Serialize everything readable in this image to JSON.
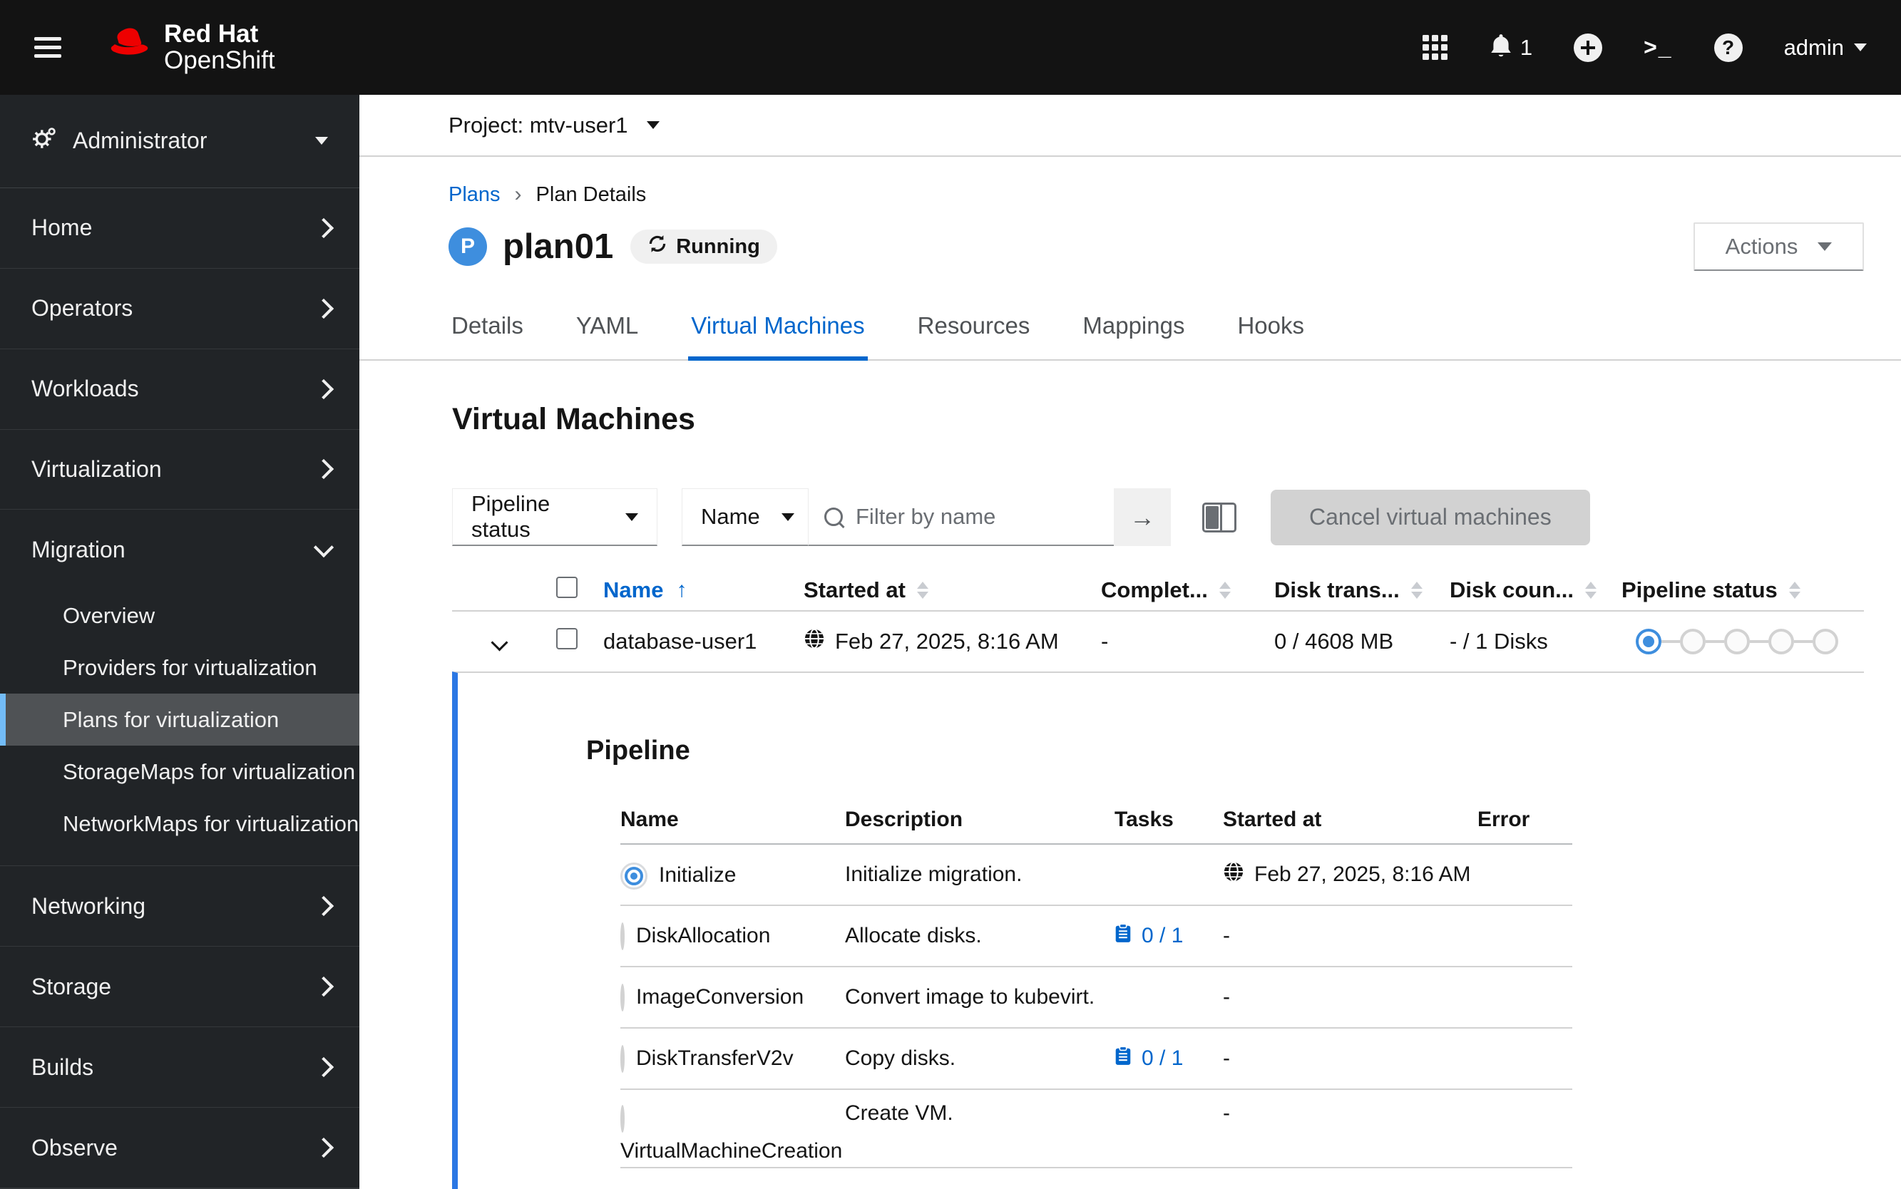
{
  "masthead": {
    "brand_line1": "Red Hat",
    "brand_line2": "OpenShift",
    "notification_count": "1",
    "username": "admin"
  },
  "sidebar": {
    "perspective": "Administrator",
    "items_before": [
      "Home",
      "Operators",
      "Workloads",
      "Virtualization"
    ],
    "migration": {
      "label": "Migration",
      "children": [
        "Overview",
        "Providers for virtualization",
        "Plans for virtualization",
        "StorageMaps for virtualization",
        "NetworkMaps for virtualization"
      ],
      "active_child": "Plans for virtualization"
    },
    "items_after": [
      "Networking",
      "Storage",
      "Builds",
      "Observe"
    ]
  },
  "project_bar": {
    "label": "Project: mtv-user1"
  },
  "page": {
    "breadcrumb": [
      "Plans",
      "Plan Details"
    ],
    "resource_badge": "P",
    "title": "plan01",
    "status": "Running",
    "actions_label": "Actions"
  },
  "tabs": [
    "Details",
    "YAML",
    "Virtual Machines",
    "Resources",
    "Mappings",
    "Hooks"
  ],
  "active_tab": "Virtual Machines",
  "main": {
    "section_title": "Virtual Machines",
    "toolbar": {
      "filter_category": "Pipeline status",
      "filter_attribute": "Name",
      "search_placeholder": "Filter by name",
      "cancel_button": "Cancel virtual machines"
    },
    "vm_table": {
      "headers": [
        "Name",
        "Started at",
        "Complet...",
        "Disk trans...",
        "Disk coun...",
        "Pipeline status"
      ],
      "row": {
        "name": "database-user1",
        "started_at": "Feb 27, 2025, 8:16 AM",
        "completed": "-",
        "disk_transfer": "0 / 4608 MB",
        "disk_counter": "- / 1 Disks",
        "pipeline_total_steps": 5,
        "pipeline_current_step": 1
      }
    },
    "pipeline": {
      "heading": "Pipeline",
      "headers": [
        "Name",
        "Description",
        "Tasks",
        "Started at",
        "Error"
      ],
      "rows": [
        {
          "name": "Initialize",
          "description": "Initialize migration.",
          "tasks": "",
          "started_at": "Feb 27, 2025, 8:16 AM",
          "error": "",
          "state": "running"
        },
        {
          "name": "DiskAllocation",
          "description": "Allocate disks.",
          "tasks": "0 / 1",
          "started_at": "-",
          "error": "",
          "state": "pending"
        },
        {
          "name": "ImageConversion",
          "description": "Convert image to kubevirt.",
          "tasks": "",
          "started_at": "-",
          "error": "",
          "state": "pending"
        },
        {
          "name": "DiskTransferV2v",
          "description": "Copy disks.",
          "tasks": "0 / 1",
          "started_at": "-",
          "error": "",
          "state": "pending"
        },
        {
          "name": "VirtualMachineCreation",
          "description": "Create VM.",
          "tasks": "",
          "started_at": "-",
          "error": "",
          "state": "pending"
        }
      ]
    }
  },
  "colors": {
    "brand_red": "#ee0000",
    "link_blue": "#0066cc",
    "icon_blue": "#3e8ede",
    "nav_selected_bar": "#73bcf7",
    "expanded_border": "#2b77e4",
    "disabled_button_bg": "#d2d2d2"
  }
}
